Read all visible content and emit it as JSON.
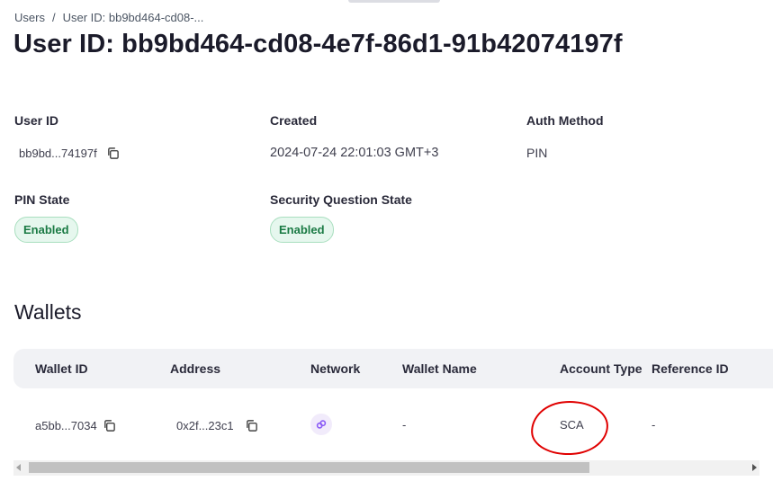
{
  "breadcrumb": {
    "root": "Users",
    "separator": "/",
    "current": "User ID: bb9bd464-cd08-..."
  },
  "title": "User ID: bb9bd464-cd08-4e7f-86d1-91b42074197f",
  "details": {
    "user_id": {
      "label": "User ID",
      "value": "bb9bd...74197f"
    },
    "created": {
      "label": "Created",
      "value": "2024-07-24 22:01:03 GMT+3"
    },
    "auth_method": {
      "label": "Auth Method",
      "value": "PIN"
    },
    "pin_state": {
      "label": "PIN State",
      "value": "Enabled"
    },
    "security_question_state": {
      "label": "Security Question State",
      "value": "Enabled"
    }
  },
  "wallets": {
    "title": "Wallets",
    "columns": [
      "Wallet ID",
      "Address",
      "Network",
      "Wallet Name",
      "Account Type",
      "Reference ID"
    ],
    "rows": [
      {
        "wallet_id": "a5bb...7034",
        "address": "0x2f...23c1",
        "network_icon": "link-icon",
        "wallet_name": "-",
        "account_type": "SCA",
        "reference_id": "-"
      }
    ]
  },
  "colors": {
    "badge_bg": "#e6f7ee",
    "badge_text": "#1a7a44",
    "network_icon": "#8b5cf6",
    "annotation": "#e00000"
  }
}
